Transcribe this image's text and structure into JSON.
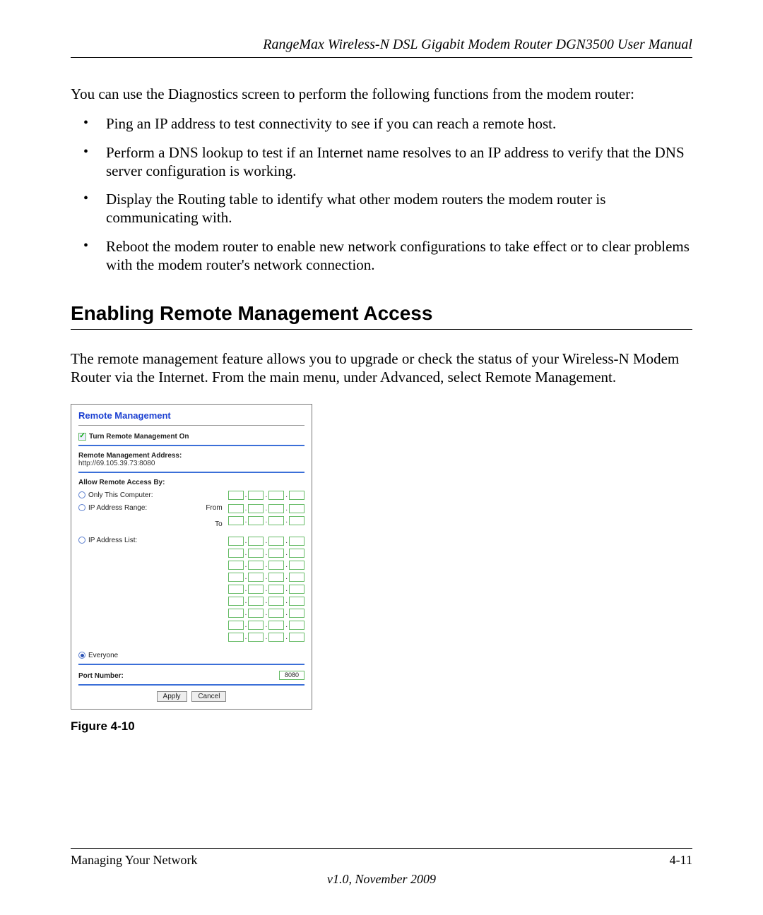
{
  "header": {
    "running_title": "RangeMax Wireless-N DSL Gigabit Modem Router DGN3500 User Manual"
  },
  "intro": "You can use the Diagnostics screen to perform the following functions from the modem router:",
  "bullets": [
    "Ping an IP address to test connectivity to see if you can reach a remote host.",
    "Perform a DNS lookup to test if an Internet name resolves to an IP address to verify that the DNS server configuration is working.",
    "Display the Routing table to identify what other modem routers the modem router is communicating with.",
    "Reboot the modem router to enable new network configurations to take effect or to clear problems with the modem router's network connection."
  ],
  "section_heading": "Enabling Remote Management Access",
  "section_body": "The remote management feature allows you to upgrade or check the status of your Wireless-N Modem Router via the Internet. From the main menu, under Advanced, select Remote Management.",
  "figure": {
    "caption": "Figure 4-10",
    "panel_title": "Remote Management",
    "checkbox_label": "Turn Remote Management On",
    "addr_label": "Remote Management Address:",
    "addr_value": "http://69.105.39.73:8080",
    "access_by_label": "Allow Remote Access By:",
    "opt_only": "Only This Computer:",
    "opt_range": "IP Address Range:",
    "opt_list": "IP Address List:",
    "opt_everyone": "Everyone",
    "from_label": "From",
    "to_label": "To",
    "port_label": "Port Number:",
    "port_value": "8080",
    "apply": "Apply",
    "cancel": "Cancel"
  },
  "footer": {
    "left": "Managing Your Network",
    "right": "4-11",
    "version": "v1.0, November 2009"
  }
}
